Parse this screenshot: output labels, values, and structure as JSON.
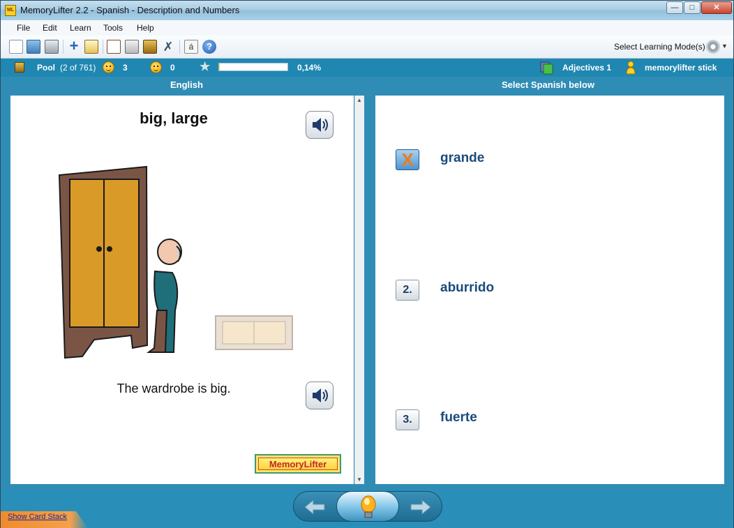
{
  "window": {
    "title": "MemoryLifter 2.2 - Spanish - Description and Numbers",
    "icon_text": "ML"
  },
  "menu": [
    "File",
    "Edit",
    "Learn",
    "Tools",
    "Help"
  ],
  "toolbar": {
    "mode_label": "Select Learning Mode(s)",
    "special_char": "á"
  },
  "status": {
    "pool_label": "Pool",
    "pool_count": "(2 of 761)",
    "smiley_count": "3",
    "sad_count": "0",
    "progress_percent": 0.14,
    "progress_text": "0,14%",
    "chapter": "Adjectives 1",
    "user": "memorylifter stick"
  },
  "headers": {
    "left": "English",
    "right": "Select Spanish below"
  },
  "card": {
    "question": "big, large",
    "sentence": "The wardrobe is big.",
    "logo_text": "MemoryLifter"
  },
  "answers": [
    {
      "label": "X",
      "text": "grande",
      "state": "wrong"
    },
    {
      "label": "2.",
      "text": "aburrido",
      "state": "normal"
    },
    {
      "label": "3.",
      "text": "fuerte",
      "state": "normal"
    }
  ],
  "footer": {
    "show_card_stack": "Show Card Stack"
  }
}
